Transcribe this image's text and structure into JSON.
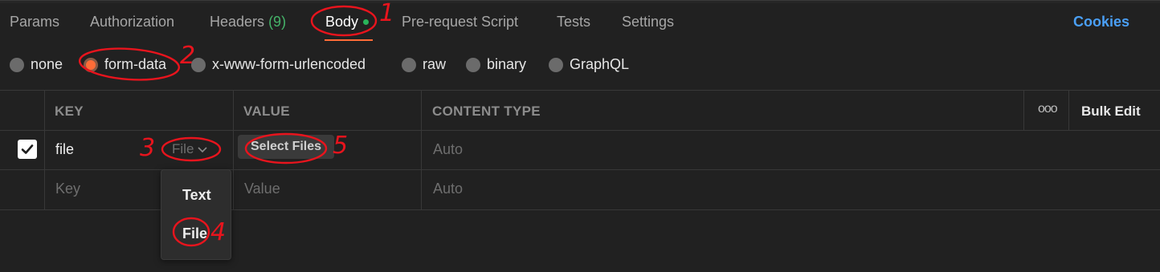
{
  "tabs": [
    {
      "label": "Params"
    },
    {
      "label": "Authorization"
    },
    {
      "label": "Headers",
      "count": "(9)"
    },
    {
      "label": "Body"
    },
    {
      "label": "Pre-request Script"
    },
    {
      "label": "Tests"
    },
    {
      "label": "Settings"
    }
  ],
  "cookies_label": "Cookies",
  "body_types": [
    "none",
    "form-data",
    "x-www-form-urlencoded",
    "raw",
    "binary",
    "GraphQL"
  ],
  "selected_body_type": "form-data",
  "table": {
    "headers": {
      "key": "KEY",
      "value": "VALUE",
      "content_type": "CONTENT TYPE"
    },
    "more_label": "ooo",
    "bulk_edit_label": "Bulk Edit",
    "rows": [
      {
        "checked": true,
        "key": "file",
        "type": "File",
        "value_button": "Select Files",
        "content_type_placeholder": "Auto"
      }
    ],
    "empty_row": {
      "key_placeholder": "Key",
      "value_placeholder": "Value",
      "content_type_placeholder": "Auto"
    }
  },
  "type_dropdown": {
    "options": [
      "Text",
      "File"
    ]
  },
  "annotations": [
    "1",
    "2",
    "3",
    "4",
    "5"
  ],
  "colors": {
    "accent": "#ff6c37",
    "link": "#4a9ff5",
    "annotation": "#e8141d",
    "count": "#45b369"
  }
}
